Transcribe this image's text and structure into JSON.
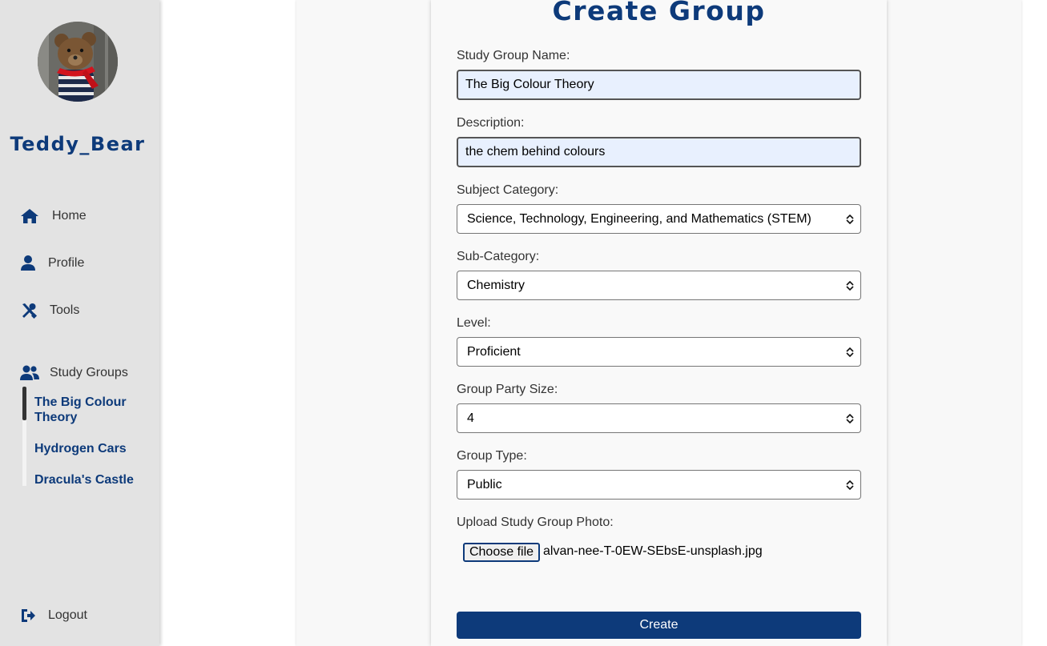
{
  "user": {
    "name": "Teddy_Bear"
  },
  "nav": {
    "home": "Home",
    "profile": "Profile",
    "tools": "Tools",
    "study_groups": "Study Groups",
    "logout": "Logout"
  },
  "groups": [
    {
      "name": "The Big Colour Theory",
      "active": true
    },
    {
      "name": "Hydrogen Cars",
      "active": false
    },
    {
      "name": "Dracula's Castle",
      "active": false
    }
  ],
  "form": {
    "title": "Create Group",
    "name_label": "Study Group Name:",
    "name_value": "The Big Colour Theory",
    "desc_label": "Description:",
    "desc_value": "the chem behind colours",
    "subject_label": "Subject Category:",
    "subject_value": "Science, Technology, Engineering, and Mathematics (STEM)",
    "subcat_label": "Sub-Category:",
    "subcat_value": "Chemistry",
    "level_label": "Level:",
    "level_value": "Proficient",
    "size_label": "Group Party Size:",
    "size_value": "4",
    "type_label": "Group Type:",
    "type_value": "Public",
    "upload_label": "Upload Study Group Photo:",
    "choose_file": "Choose file",
    "file_name": "alvan-nee-T-0EW-SEbsE-unsplash.jpg",
    "submit": "Create"
  },
  "colors": {
    "brand": "#0d3a7a",
    "sidebar_bg": "#e3e3e3",
    "input_autofill_bg": "#e8f0fe"
  },
  "icons": {
    "home": "home-icon",
    "profile": "user-icon",
    "tools": "tools-icon",
    "study_groups": "users-icon",
    "logout": "logout-icon"
  }
}
